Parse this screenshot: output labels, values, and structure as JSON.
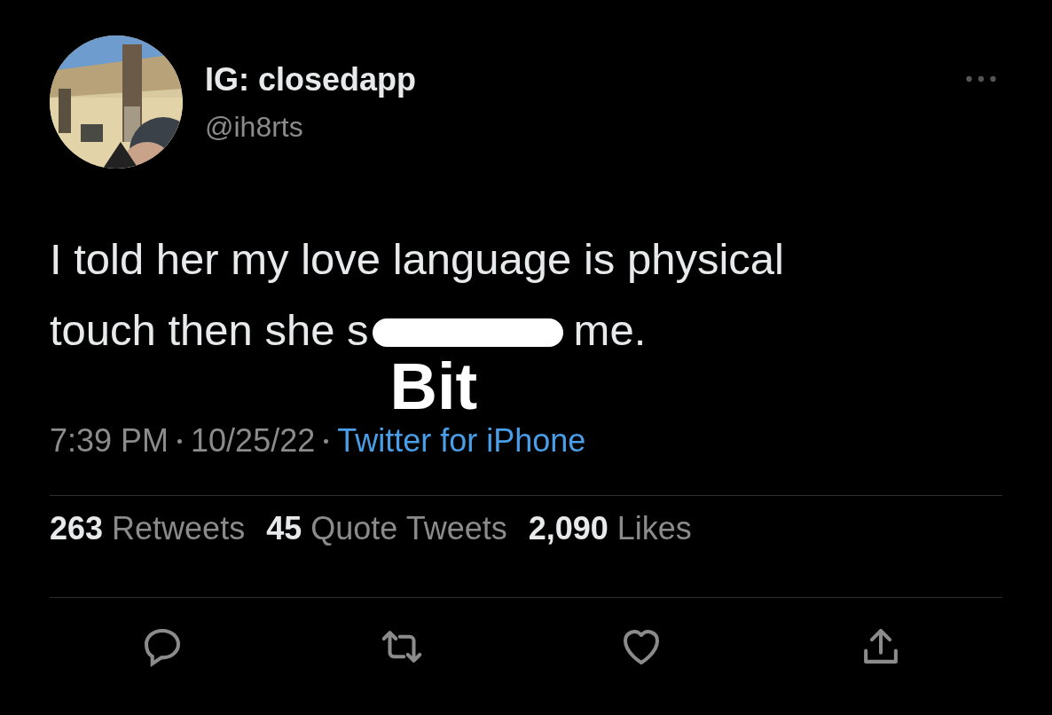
{
  "author": {
    "name": "IG: closedapp",
    "handle": "@ih8rts"
  },
  "tweet": {
    "first_line": "I told her my love language is physical",
    "text_before": "touch then she s",
    "text_after": "me.",
    "overlay_text": "Bit"
  },
  "meta": {
    "time": "7:39 PM",
    "date": "10/25/22",
    "source": "Twitter for iPhone"
  },
  "stats": [
    {
      "text": "**263** Retweets"
    },
    {
      "text": "**45** Quote Tweets"
    },
    {
      "text": "**2,090** Likes"
    }
  ],
  "actions": [
    {
      "kind": "reply"
    },
    {
      "kind": "retweet"
    },
    {
      "kind": "like"
    },
    {
      "kind": "share"
    }
  ]
}
